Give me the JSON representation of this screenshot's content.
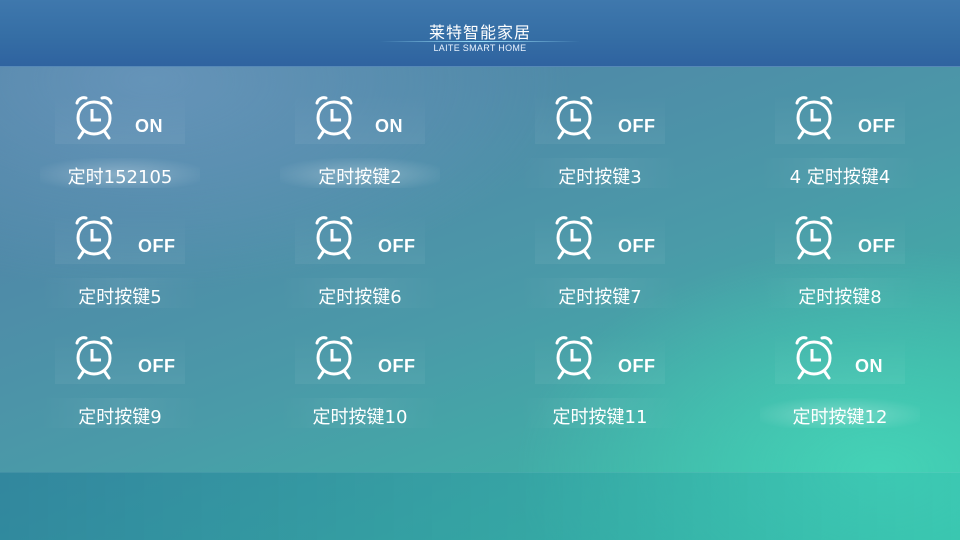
{
  "header": {
    "title": "莱特智能家居",
    "subtitle": "LAITE SMART HOME"
  },
  "timers": [
    {
      "label": "定时152105",
      "state": "ON",
      "icon": "alarm-clock-icon"
    },
    {
      "label": "定时按键2",
      "state": "ON",
      "icon": "alarm-clock-icon"
    },
    {
      "label": "定时按键3",
      "state": "OFF",
      "icon": "alarm-clock-icon"
    },
    {
      "label": "4 定时按键4",
      "state": "OFF",
      "icon": "alarm-clock-icon"
    },
    {
      "label": "定时按键5",
      "state": "OFF",
      "icon": "alarm-clock-icon"
    },
    {
      "label": "定时按键6",
      "state": "OFF",
      "icon": "alarm-clock-icon"
    },
    {
      "label": "定时按键7",
      "state": "OFF",
      "icon": "alarm-clock-icon"
    },
    {
      "label": "定时按键8",
      "state": "OFF",
      "icon": "alarm-clock-icon"
    },
    {
      "label": "定时按键9",
      "state": "OFF",
      "icon": "alarm-clock-icon"
    },
    {
      "label": "定时按键10",
      "state": "OFF",
      "icon": "alarm-clock-icon"
    },
    {
      "label": "定时按键11",
      "state": "OFF",
      "icon": "alarm-clock-icon"
    },
    {
      "label": "定时按键12",
      "state": "ON",
      "icon": "alarm-clock-icon"
    }
  ],
  "colors": {
    "header_bg": "#356ea5",
    "accent_glow": "#a0e6ff",
    "bg_teal": "#35bfa8",
    "text": "#ffffff"
  }
}
